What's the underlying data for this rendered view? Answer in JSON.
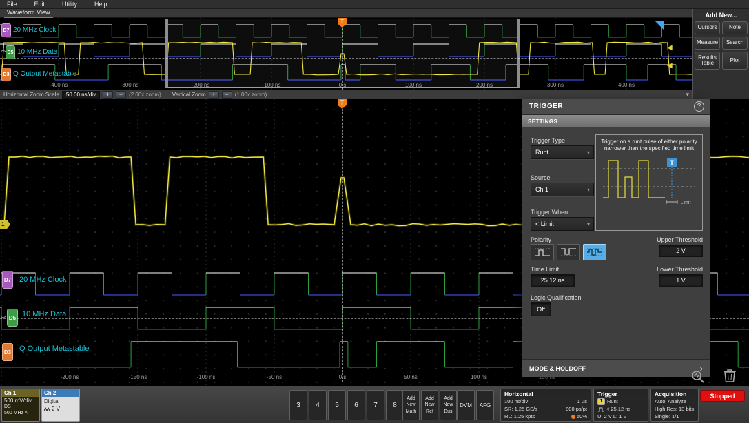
{
  "colors": {
    "accent_cyan": "#18c4d8",
    "trace_yellow": "#f0e63c",
    "trigger_orange": "#ef7c1a",
    "selected_blue": "#57aee6",
    "stopped_red": "#e01010"
  },
  "menubar": {
    "items": [
      {
        "label": "File"
      },
      {
        "label": "Edit"
      },
      {
        "label": "Utility"
      },
      {
        "label": "Help"
      }
    ]
  },
  "view_tab": {
    "label": "Waveform View"
  },
  "overview": {
    "channels": [
      {
        "badge": "D7",
        "label": "20 MHz Clock"
      },
      {
        "badge": "D5",
        "label": "10 MHz Data",
        "handle": "<>"
      },
      {
        "badge": "D3",
        "label": "Q Output Metastable"
      }
    ],
    "time_labels": [
      "-400 ns",
      "-300 ns",
      "-200 ns",
      "-100 ns",
      "0 s",
      "100 ns",
      "200 ns",
      "300 ns",
      "400 ns"
    ],
    "trigger_marker": "T"
  },
  "add_new_panel": {
    "title": "Add New...",
    "buttons": [
      {
        "label": "Cursors"
      },
      {
        "label": "Note"
      },
      {
        "label": "Measure"
      },
      {
        "label": "Search"
      },
      {
        "label": "Results Table"
      },
      {
        "label": "Plot"
      }
    ]
  },
  "zoom_bar": {
    "horizontal_label": "Horizontal Zoom Scale",
    "horizontal_value": "50.00 ns/div",
    "plus": "+",
    "minus": "−",
    "horizontal_zoom": "(2.00x zoom)",
    "vertical_label": "Vertical Zoom",
    "vertical_zoom": "(1.00x zoom)",
    "collapse_icon": "▾"
  },
  "main_view": {
    "channels": [
      {
        "badge": "D7",
        "label": "20 MHz Clock"
      },
      {
        "badge": "D5",
        "label": "10 MHz Data",
        "handle": "<>"
      },
      {
        "badge": "D3",
        "label": "Q Output Metastable"
      }
    ],
    "time_labels": [
      "-200 ns",
      "-150 ns",
      "-100 ns",
      "-50 ns",
      "0 s",
      "50 ns",
      "100 ns",
      "150 ns"
    ],
    "trigger_marker": "T",
    "ch1_marker": "1"
  },
  "trigger_panel": {
    "title": "TRIGGER",
    "help_icon": "?",
    "settings_header": "SETTINGS",
    "trigger_type_label": "Trigger Type",
    "trigger_type_value": "Runt",
    "description": "Trigger on a runt pulse of either polarity narrower than the specified time limit",
    "diagram_limit_label": "Limit",
    "diagram_trigger_marker": "T",
    "source_label": "Source",
    "source_value": "Ch 1",
    "trigger_when_label": "Trigger When",
    "trigger_when_value": "< Limit",
    "polarity_label": "Polarity",
    "upper_threshold_label": "Upper Threshold",
    "upper_threshold_value": "2 V",
    "time_limit_label": "Time Limit",
    "time_limit_value": "25.12 ns",
    "lower_threshold_label": "Lower Threshold",
    "lower_threshold_value": "1 V",
    "logic_label": "Logic Qualification",
    "logic_value": "Off",
    "mode_holdoff_label": "MODE & HOLDOFF",
    "expand_icon": "›"
  },
  "status_bar": {
    "ch1": {
      "name": "Ch 1",
      "scale": "500 mV/div",
      "probe": "DS",
      "bandwidth": "500 MHz"
    },
    "ch2": {
      "name": "Ch 2",
      "mode": "Digital",
      "threshold": "2 V"
    },
    "channel_buttons": [
      {
        "label": "3"
      },
      {
        "label": "4"
      },
      {
        "label": "5"
      },
      {
        "label": "6"
      },
      {
        "label": "7"
      },
      {
        "label": "8"
      }
    ],
    "add_buttons": [
      {
        "l1": "Add",
        "l2": "New",
        "l3": "Math"
      },
      {
        "l1": "Add",
        "l2": "New",
        "l3": "Ref"
      },
      {
        "l1": "Add",
        "l2": "New",
        "l3": "Bus"
      }
    ],
    "dvm_label": "DVM",
    "afg_label": "AFG",
    "horizontal": {
      "title": "Horizontal",
      "scale": "100 ns/div",
      "duration": "1 µs",
      "sample_rate": "SR: 1.25 GS/s",
      "resolution": "800 ps/pt",
      "record_length": "RL: 1.25 kpts",
      "position": "50%"
    },
    "trigger": {
      "title": "Trigger",
      "source_badge": "1",
      "type": "Runt",
      "condition": "< 25.12 ns",
      "thresholds": "U: 2 V  L: 1 V"
    },
    "acquisition": {
      "title": "Acquisition",
      "mode": "Auto,  Analyze",
      "detail": "High Res: 13 bits",
      "single": "Single: 1/1"
    },
    "stopped_label": "Stopped"
  }
}
